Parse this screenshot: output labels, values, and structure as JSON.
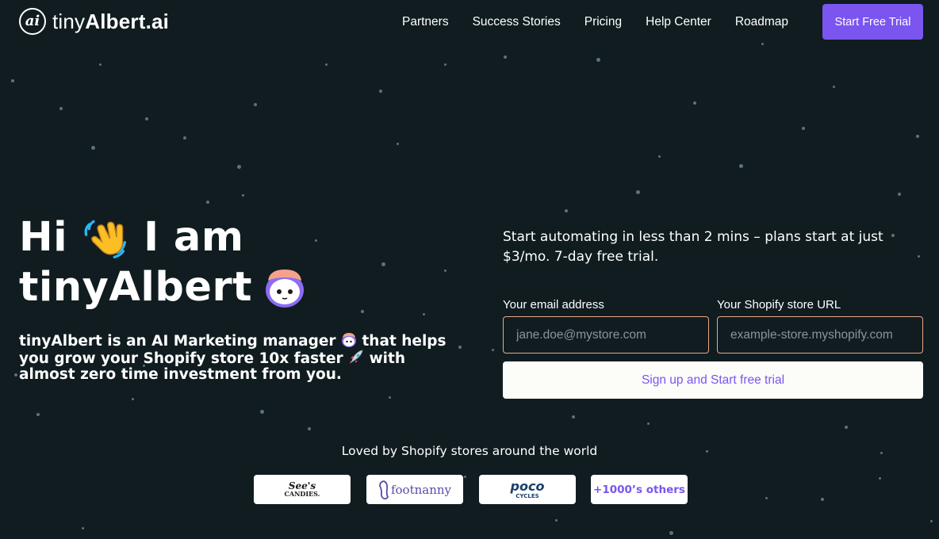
{
  "colors": {
    "background": "#101c20",
    "accent": "#7a55f0",
    "input_border": "#e9a885",
    "button_bg": "#fcfcf9"
  },
  "header": {
    "logo_mark": "ai",
    "logo_light": "tiny",
    "logo_bold": "Albert.ai",
    "nav": [
      "Partners",
      "Success Stories",
      "Pricing",
      "Help Center",
      "Roadmap"
    ],
    "cta": "Start Free Trial"
  },
  "hero": {
    "title_line1_a": "Hi",
    "title_line1_b": "I am",
    "title_line2": "tinyAlbert",
    "subtitle_a": "tinyAlbert is an AI Marketing manager",
    "subtitle_b": "that helps you grow your Shopify store 10x faster",
    "subtitle_c": "with almost zero time investment from you."
  },
  "form": {
    "intro": "Start automating in less than 2 mins – plans start at just $3/mo. 7-day free trial.",
    "email_label": "Your email address",
    "email_placeholder": "jane.doe@mystore.com",
    "store_label": "Your Shopify store URL",
    "store_placeholder": "example-store.myshopify.com",
    "submit": "Sign up and Start free trial"
  },
  "social": {
    "heading": "Loved by Shopify stores around the world",
    "brands": {
      "sees_line1": "See's",
      "sees_line2": "CANDIES.",
      "footnanny": "footnanny",
      "poco_line1": "poco",
      "poco_line2": "CYCLES",
      "more": "+1000’s others"
    }
  }
}
